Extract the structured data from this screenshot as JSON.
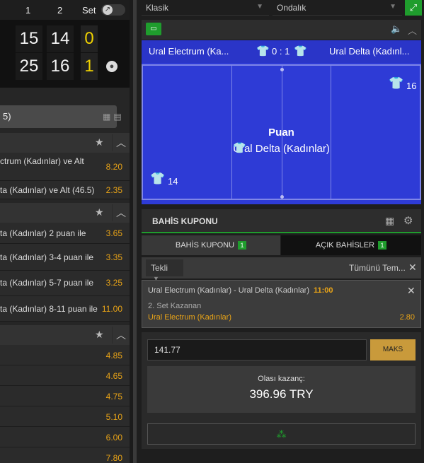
{
  "scoreboard": {
    "headers": {
      "set1": "1",
      "set2": "2",
      "set": "Set"
    },
    "home": {
      "set1": "15",
      "set2": "14",
      "sets": "0"
    },
    "away": {
      "set1": "25",
      "set2": "16",
      "sets": "1"
    },
    "serving": "away"
  },
  "left": {
    "search_text": "5)",
    "groups": [
      {
        "rows": [
          {
            "label": "ctrum (Kadınlar) ve Alt",
            "odd": "8.20"
          },
          {
            "label": "ta (Kadınlar) ve Alt (46.5)",
            "odd": "2.35"
          }
        ]
      },
      {
        "rows": [
          {
            "label": "ta (Kadınlar) 2 puan ile",
            "odd": "3.65"
          },
          {
            "label": "ta (Kadınlar) 3-4 puan ile",
            "odd": "3.35"
          },
          {
            "label": "ta (Kadınlar) 5-7 puan ile",
            "odd": "3.25"
          },
          {
            "label": "ta (Kadınlar) 8-11 puan ile",
            "odd": "11.00"
          }
        ]
      },
      {
        "rows": [
          {
            "label": "",
            "odd": "4.85"
          },
          {
            "label": "",
            "odd": "4.65"
          },
          {
            "label": "",
            "odd": "4.75"
          },
          {
            "label": "",
            "odd": "5.10"
          },
          {
            "label": "",
            "odd": "6.00"
          },
          {
            "label": "",
            "odd": "7.80"
          }
        ]
      }
    ]
  },
  "selectors": {
    "view": "Klasik",
    "odds_format": "Ondalık"
  },
  "match": {
    "home": "Ural Electrum (Ka...",
    "away": "Ural Delta (Kadınl...",
    "score": "0 : 1",
    "point_title": "Puan",
    "point_team": "Ural Delta (Kadınlar)",
    "home_number": "14",
    "away_number": "16",
    "home_shirt_color": "#e53935",
    "away_shirt_color": "#a6d4f5"
  },
  "coupon": {
    "title": "BAHİS KUPONU",
    "tabs": [
      {
        "label": "BAHİS KUPONU",
        "count": "1"
      },
      {
        "label": "AÇIK BAHİSLER",
        "count": "1"
      }
    ],
    "type": "Tekli",
    "clear_all": "Tümünü Tem...",
    "bet": {
      "match": "Ural Electrum (Kadınlar) - Ural Delta (Kadınlar)",
      "time": "11:00",
      "market": "2. Set Kazanan",
      "pick": "Ural Electrum (Kadınlar)",
      "odd": "2.80"
    },
    "stake": "141.77",
    "max_label": "MAKS",
    "possible_win_label": "Olası kazanç:",
    "possible_win_value": "396.96 TRY"
  },
  "colors": {
    "accent_green": "#1f9d2d",
    "odds_orange": "#e8a317",
    "field_blue": "#2e3bd6"
  }
}
